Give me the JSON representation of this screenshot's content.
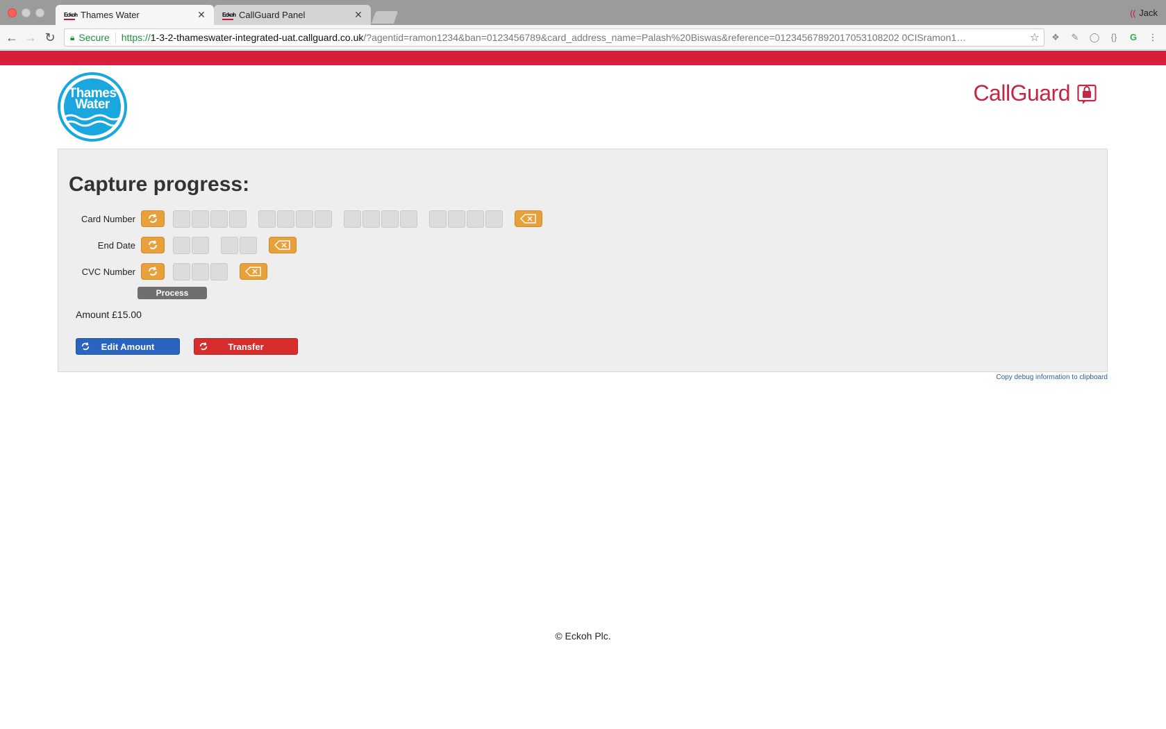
{
  "browser": {
    "tabs": [
      {
        "title": "Thames Water",
        "favicon": "eckoh"
      },
      {
        "title": "CallGuard Panel",
        "favicon": "eckoh"
      }
    ],
    "profile_name": "Jack",
    "url": {
      "security_label": "Secure",
      "scheme": "https://",
      "host": "1-3-2-thameswater-integrated-uat.callguard.co.uk",
      "path": "/?agentid=ramon1234&ban=0123456789&card_address_name=Palash%20Biswas&reference=01234567892017053108202 0CISramon1…"
    }
  },
  "header": {
    "client_logo_text_line1": "Thames",
    "client_logo_text_line2": "Water",
    "brand_logo_text": "CallGuard"
  },
  "capture": {
    "title": "Capture progress:",
    "fields": [
      {
        "label": "Card Number",
        "groups": [
          4,
          4,
          4,
          4
        ]
      },
      {
        "label": "End Date",
        "groups": [
          2,
          2
        ]
      },
      {
        "label": "CVC Number",
        "groups": [
          3
        ]
      }
    ],
    "process_label": "Process",
    "amount_text": "Amount £15.00",
    "edit_amount_label": "Edit Amount",
    "transfer_label": "Transfer"
  },
  "debug_link": "Copy debug information to clipboard",
  "footer": "© Eckoh Plc.",
  "colors": {
    "brand_red": "#d71f3b",
    "callguard_red": "#c42645",
    "thames_blue": "#1aa6df",
    "orange": "#e8a13a",
    "blue_button": "#2864c0",
    "red_button": "#d72d2d"
  }
}
